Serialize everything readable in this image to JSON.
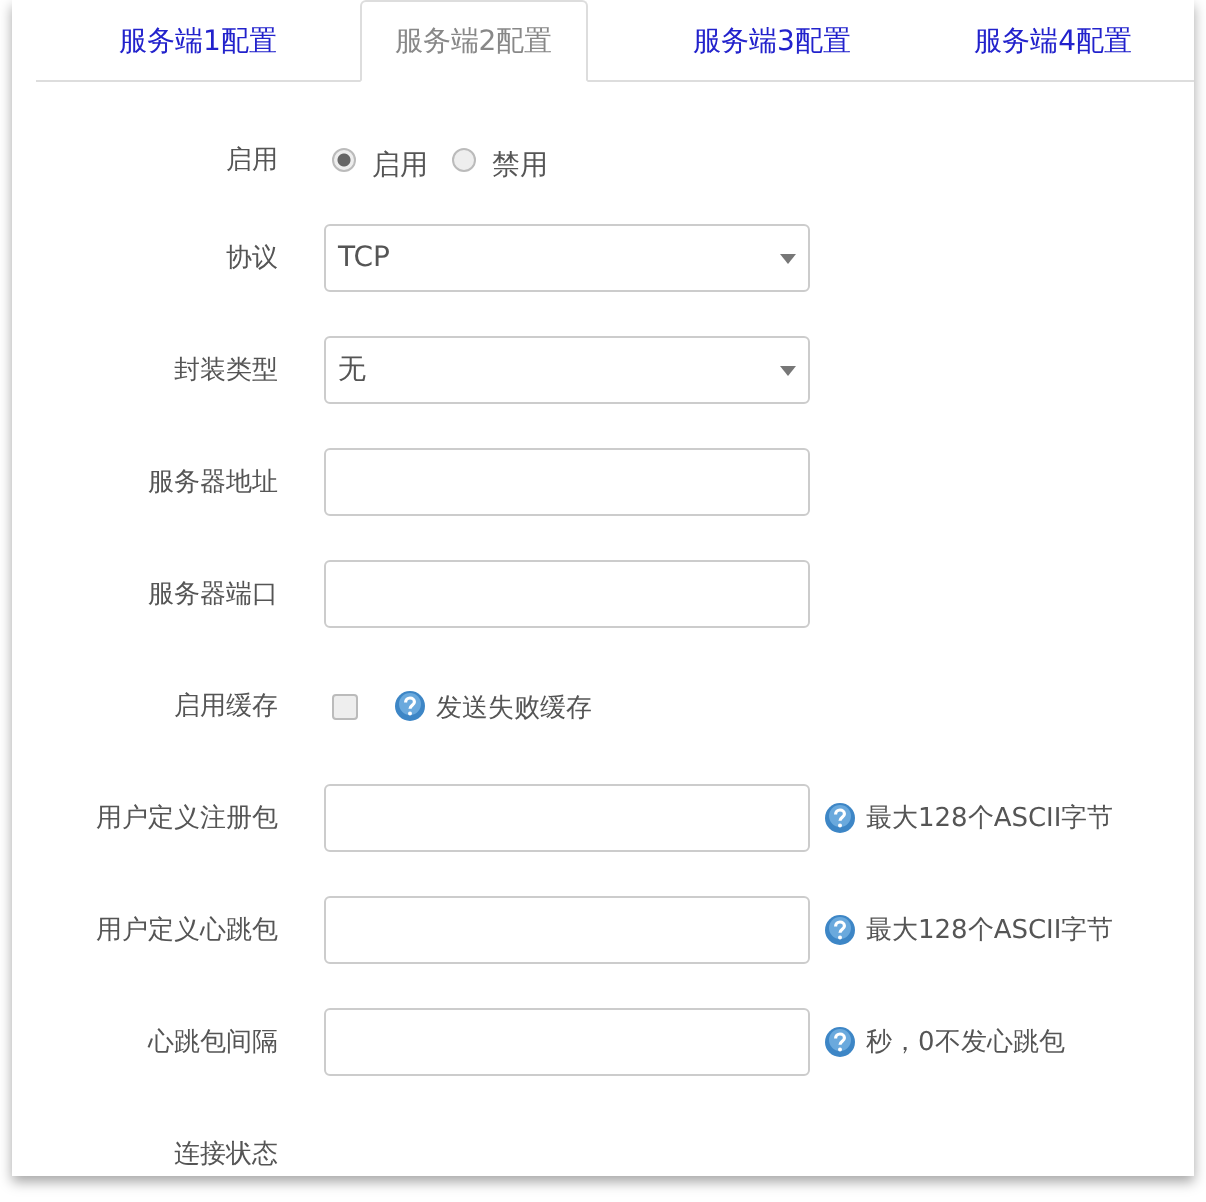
{
  "tabs": [
    {
      "label": "服务端1配置",
      "selected": false
    },
    {
      "label": "服务端2配置",
      "selected": true
    },
    {
      "label": "服务端3配置",
      "selected": false
    },
    {
      "label": "服务端4配置",
      "selected": false
    }
  ],
  "fields": [
    {
      "kind": "radio",
      "label": "启用",
      "options": [
        {
          "label": "启用",
          "selected": true
        },
        {
          "label": "禁用",
          "selected": false
        }
      ]
    },
    {
      "kind": "select",
      "label": "协议",
      "value": "TCP"
    },
    {
      "kind": "select",
      "label": "封装类型",
      "value": "无"
    },
    {
      "kind": "text",
      "label": "服务器地址"
    },
    {
      "kind": "text",
      "label": "服务器端口"
    },
    {
      "kind": "checkbox",
      "label": "启用缓存",
      "checked": false,
      "help": "发送失败缓存"
    },
    {
      "kind": "text",
      "label": "用户定义注册包",
      "help": "最大128个ASCII字节"
    },
    {
      "kind": "text",
      "label": "用户定义心跳包",
      "help": "最大128个ASCII字节"
    },
    {
      "kind": "text",
      "label": "心跳包间隔",
      "help": "秒，0不发心跳包"
    },
    {
      "kind": "status",
      "label": "连接状态"
    }
  ]
}
